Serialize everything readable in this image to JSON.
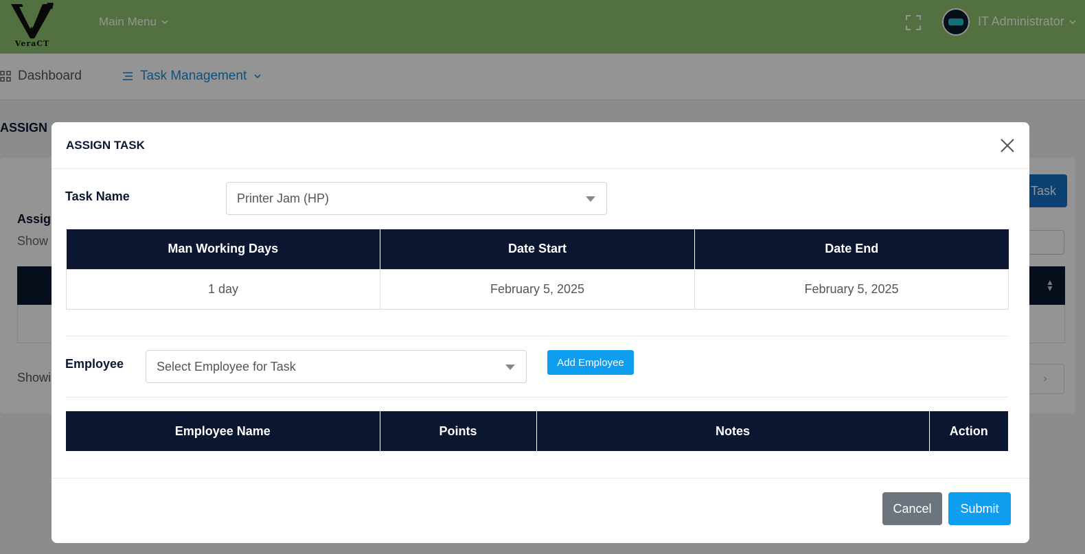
{
  "header": {
    "logo_text": "VeraCT",
    "main_menu_label": "Main Menu",
    "user_name": "IT Administrator"
  },
  "nav": {
    "dashboard_label": "Dashboard",
    "task_management_label": "Task Management"
  },
  "background": {
    "page_title": "ASSIGN",
    "assign_button_label": "Task",
    "card_title": "Assig",
    "show_label": "Show",
    "showing_label": "Showi",
    "pager_next": "›"
  },
  "modal": {
    "title": "ASSIGN TASK",
    "task_name_label": "Task Name",
    "task_name_value": "Printer Jam (HP)",
    "task_table": {
      "headers": [
        "Man Working Days",
        "Date Start",
        "Date End"
      ],
      "row": [
        "1 day",
        "February 5, 2025",
        "February 5, 2025"
      ]
    },
    "employee_label": "Employee",
    "employee_placeholder": "Select Employee for Task",
    "add_employee_label": "Add Employee",
    "employee_table": {
      "headers": [
        "Employee Name",
        "Points",
        "Notes",
        "Action"
      ]
    },
    "cancel_label": "Cancel",
    "submit_label": "Submit"
  },
  "colors": {
    "header_green": "#8dc16f",
    "navy": "#0b1730",
    "primary_blue": "#0f9df0",
    "nav_active": "#1c8ad8",
    "cancel_gray": "#6c757d"
  }
}
